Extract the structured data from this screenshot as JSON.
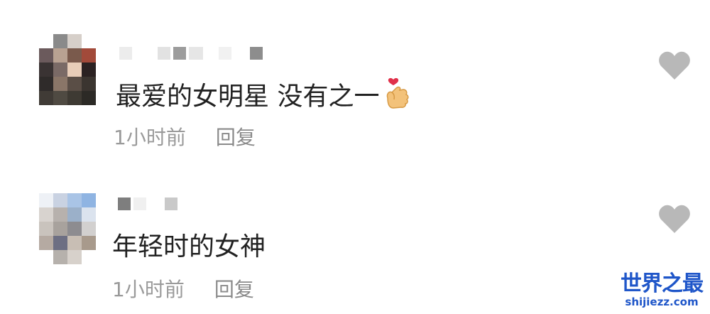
{
  "comments": [
    {
      "text": "最爱的女明星 没有之一",
      "emoji": "finger-heart-icon",
      "time": "1小时前",
      "reply_label": "回复"
    },
    {
      "text": "年轻时的女神",
      "time": "1小时前",
      "reply_label": "回复"
    }
  ],
  "watermark": {
    "title": "世界之最",
    "url": "shijiezz.com"
  },
  "colors": {
    "text": "#222222",
    "meta": "#9a9a9a",
    "heart": "#b8b8b8",
    "watermark": "#1f56c9"
  }
}
